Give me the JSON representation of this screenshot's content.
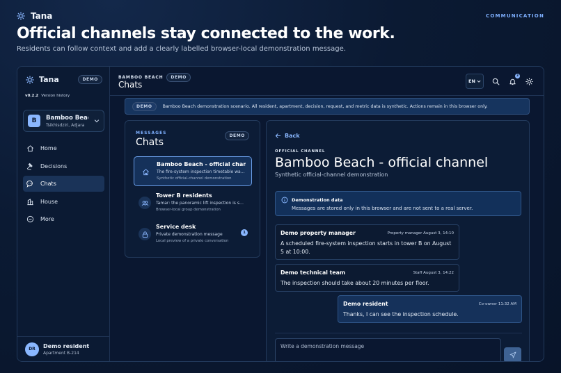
{
  "topbar": {
    "brand_name": "Tana",
    "section_tag": "COMMUNICATION"
  },
  "hero": {
    "title": "Official channels stay connected to the work.",
    "subtitle": "Residents can follow context and add a clearly labelled browser-local demonstration message."
  },
  "sidebar": {
    "brand_name": "Tana",
    "badge": "DEMO",
    "version": "v0.2.2",
    "version_link": "Version history",
    "property": {
      "initial": "B",
      "name": "Bamboo Beach",
      "location": "Tsikhisdziri, Adjara"
    },
    "nav": [
      {
        "label": "Home",
        "icon": "home-icon"
      },
      {
        "label": "Decisions",
        "icon": "gavel-icon"
      },
      {
        "label": "Chats",
        "icon": "chat-bubble-icon",
        "active": true
      },
      {
        "label": "House",
        "icon": "building-icon"
      },
      {
        "label": "More",
        "icon": "more-circle-icon"
      }
    ],
    "user": {
      "initials": "DR",
      "name": "Demo resident",
      "apartment": "Apartment B-214"
    }
  },
  "header": {
    "crumb": "BAMBOO BEACH",
    "crumb_badge": "DEMO",
    "title": "Chats",
    "lang": "EN",
    "notif_count": "3"
  },
  "banner": {
    "badge": "DEMO",
    "text": "Bamboo Beach demonstration scenario. All resident, apartment, decision, request, and metric data is synthetic. Actions remain in this browser only."
  },
  "chat_list": {
    "tag": "MESSAGES",
    "title": "Chats",
    "badge": "DEMO",
    "items": [
      {
        "title": "Bamboo Beach - official channel",
        "preview": "The fire-system inspection timetable was published for tower B.",
        "meta": "Synthetic official-channel demonstration",
        "icon": "building-icon",
        "active": true
      },
      {
        "title": "Tower B residents",
        "preview": "Tamar: the panoramic lift inspection is scheduled.",
        "meta": "Browser-local group demonstration",
        "icon": "group-icon"
      },
      {
        "title": "Service desk",
        "preview": "Private demonstration message",
        "meta": "Local preview of a private conversation",
        "icon": "lock-icon",
        "unread": "1"
      }
    ]
  },
  "conversation": {
    "back_label": "Back",
    "tag": "OFFICIAL CHANNEL",
    "title": "Bamboo Beach - official channel",
    "subtitle": "Synthetic official-channel demonstration",
    "info": {
      "title": "Demonstration data",
      "text": "Messages are stored only in this browser and are not sent to a real server."
    },
    "messages": [
      {
        "author": "Demo property manager",
        "meta": "Property manager August 3, 14:10",
        "text": "A scheduled fire-system inspection starts in tower B on August 5 at 10:00."
      },
      {
        "author": "Demo technical team",
        "meta": "Staff August 3, 14:22",
        "text": "The inspection should take about 20 minutes per floor."
      },
      {
        "author": "Demo resident",
        "meta": "Co-owner 11:32 AM",
        "text": "Thanks, I can see the inspection schedule.",
        "own": true
      }
    ],
    "composer_placeholder": "Write a demonstration message"
  },
  "colors": {
    "background": "#0b1a33",
    "accent": "#8ab7ff",
    "active_item": "#15315a",
    "border": "#223a5c"
  }
}
